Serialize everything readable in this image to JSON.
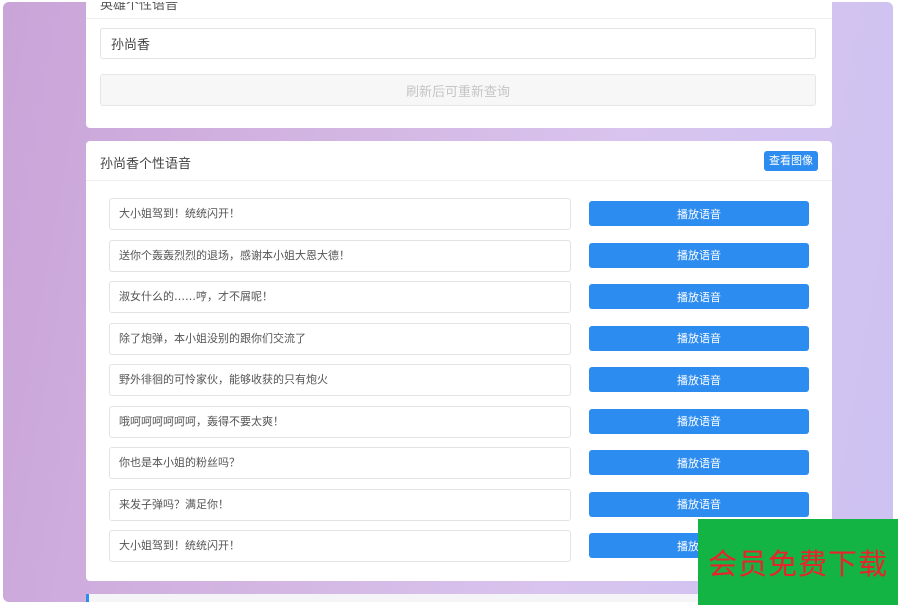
{
  "top_card": {
    "heading": "英雄个性语音",
    "input_value": "孙尚香",
    "refresh_label": "刷新后可重新查询"
  },
  "main_card": {
    "title": "孙尚香个性语音",
    "view_image_label": "查看图像",
    "play_label": "播放语音",
    "voices": [
      "大小姐驾到！统统闪开！",
      "送你个轰轰烈烈的退场，感谢本小姐大恩大德！",
      "淑女什么的……哼，才不屑呢！",
      "除了炮弹，本小姐没别的跟你们交流了",
      "野外徘徊的可怜家伙，能够收获的只有炮火",
      "哦呵呵呵呵呵呵，轰得不要太爽！",
      "你也是本小姐的粉丝吗？",
      "来发子弹吗？满足你！",
      "大小姐驾到！统统闪开！"
    ]
  },
  "banner": {
    "text": "会员免费下载",
    "background": "#14b444",
    "color": "#e8242a"
  },
  "colors": {
    "accent": "#2d8cf0"
  }
}
